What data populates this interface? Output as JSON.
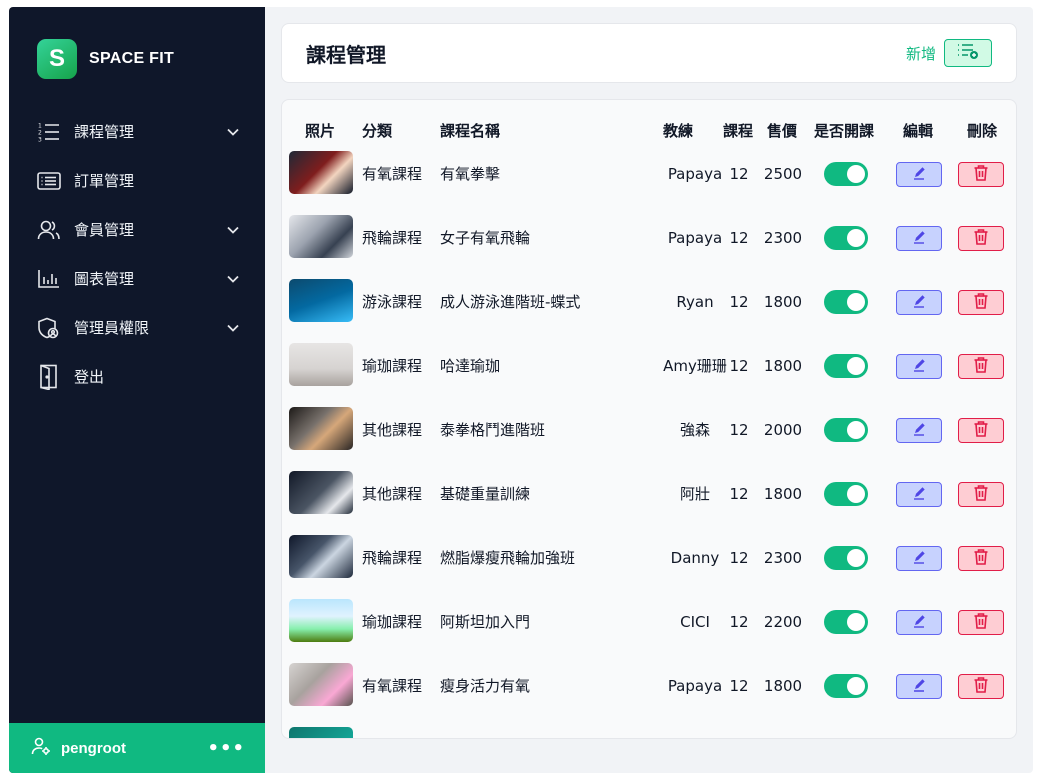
{
  "brand": {
    "logo_letter": "S",
    "name": "SPACE FIT",
    "accent": "#10b981"
  },
  "sidebar": {
    "items": [
      {
        "label": "課程管理",
        "icon": "numbered-list-icon",
        "expandable": true
      },
      {
        "label": "訂單管理",
        "icon": "list-box-icon",
        "expandable": false
      },
      {
        "label": "會員管理",
        "icon": "users-icon",
        "expandable": true
      },
      {
        "label": "圖表管理",
        "icon": "bar-chart-icon",
        "expandable": true
      },
      {
        "label": "管理員權限",
        "icon": "shield-user-icon",
        "expandable": true
      },
      {
        "label": "登出",
        "icon": "door-icon",
        "expandable": false
      }
    ]
  },
  "user": {
    "name": "pengroot",
    "more": "•••"
  },
  "header": {
    "title": "課程管理",
    "add_label": "新增"
  },
  "table": {
    "columns": [
      "照片",
      "分類",
      "課程名稱",
      "教練",
      "課程",
      "售價",
      "是否開課",
      "編輯",
      "刪除"
    ],
    "rows": [
      {
        "category": "有氧課程",
        "name": "有氧拳擊",
        "coach": "Papaya",
        "sessions": "12",
        "price": "2500",
        "open": true
      },
      {
        "category": "飛輪課程",
        "name": "女子有氧飛輪",
        "coach": "Papaya",
        "sessions": "12",
        "price": "2300",
        "open": true
      },
      {
        "category": "游泳課程",
        "name": "成人游泳進階班-蝶式",
        "coach": "Ryan",
        "sessions": "12",
        "price": "1800",
        "open": true
      },
      {
        "category": "瑜珈課程",
        "name": "哈達瑜珈",
        "coach": "Amy珊珊",
        "sessions": "12",
        "price": "1800",
        "open": true
      },
      {
        "category": "其他課程",
        "name": "泰拳格鬥進階班",
        "coach": "強森",
        "sessions": "12",
        "price": "2000",
        "open": true
      },
      {
        "category": "其他課程",
        "name": "基礎重量訓練",
        "coach": "阿壯",
        "sessions": "12",
        "price": "1800",
        "open": true
      },
      {
        "category": "飛輪課程",
        "name": "燃脂爆瘦飛輪加強班",
        "coach": "Danny",
        "sessions": "12",
        "price": "2300",
        "open": true
      },
      {
        "category": "瑜珈課程",
        "name": "阿斯坦加入門",
        "coach": "CICI",
        "sessions": "12",
        "price": "2200",
        "open": true
      },
      {
        "category": "有氧課程",
        "name": "瘦身活力有氧",
        "coach": "Papaya",
        "sessions": "12",
        "price": "1800",
        "open": true
      }
    ]
  }
}
